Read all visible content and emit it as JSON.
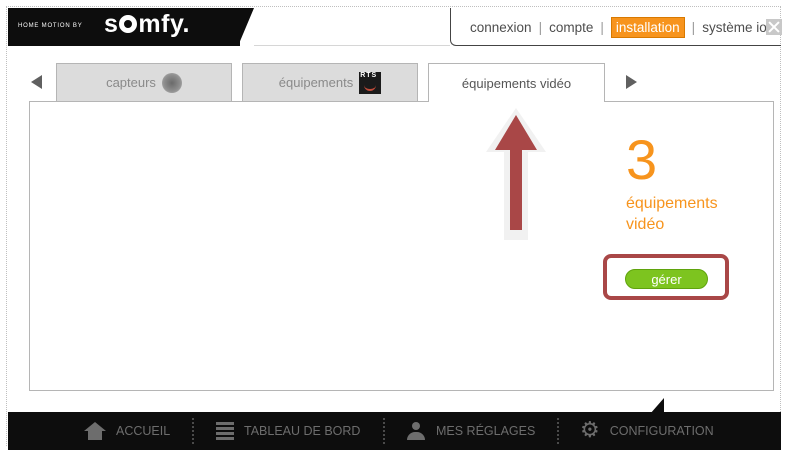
{
  "logo": {
    "tagline": "HOME MOTION BY",
    "brand_pre": "s",
    "brand_post": "mfy."
  },
  "top_nav": {
    "items": [
      {
        "label": "connexion",
        "active": false
      },
      {
        "label": "compte",
        "active": false
      },
      {
        "label": "installation",
        "active": true
      },
      {
        "label": "système io",
        "active": false
      }
    ],
    "separator": "|"
  },
  "tabs": [
    {
      "label": "capteurs",
      "icon": "sensor-icon",
      "active": false
    },
    {
      "label": "équipements",
      "icon": "rts-icon",
      "icon_text": "RTS",
      "active": false
    },
    {
      "label": "équipements vidéo",
      "active": true
    }
  ],
  "panel": {
    "count": "3",
    "count_label": "équipements vidéo",
    "manage_label": "gérer"
  },
  "bottom_nav": [
    {
      "label": "ACCUEIL",
      "icon": "home-icon"
    },
    {
      "label": "TABLEAU DE BORD",
      "icon": "dashboard-icon"
    },
    {
      "label": "MES RÉGLAGES",
      "icon": "user-icon"
    },
    {
      "label": "CONFIGURATION",
      "icon": "gear-icon"
    }
  ],
  "colors": {
    "accent": "#f7941d",
    "button": "#7dc41f",
    "annotation": "#a94747"
  }
}
